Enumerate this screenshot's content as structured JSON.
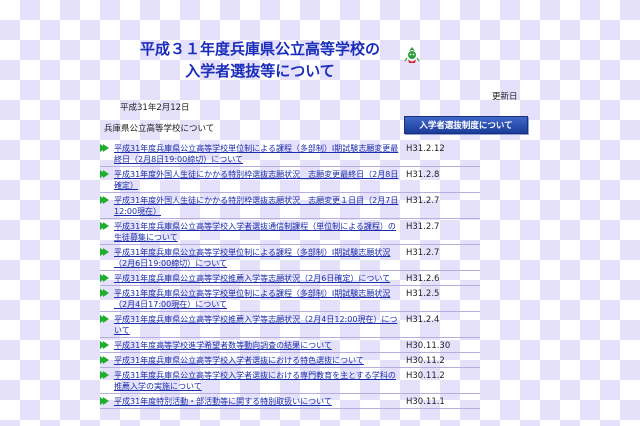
{
  "page": {
    "title_line1": "平成３１年度兵庫県公立高等学校の",
    "title_line2": "入学者選抜等について",
    "date": "平成31年2月12日",
    "update_header": "更新日",
    "section_title": "兵庫県公立高等学校について",
    "banner_label": "入学者選抜制度について"
  },
  "items": [
    {
      "text": "平成31年度兵庫県公立高等学校単位制による課程（多部制）Ⅰ期試験志願変更最終日（2月8日19:00締切）について",
      "date": "H31.2.12"
    },
    {
      "text": "平成31年度外国人生徒にかかる特別枠選抜志願状況　志願変更最終日（2月8日確定）",
      "date": "H31.2.8"
    },
    {
      "text": "平成31年度外国人生徒にかかる特別枠選抜志願状況　志願変更１日目（2月7日12:00現在）",
      "date": "H31.2.7"
    },
    {
      "text": "平成31年度兵庫県公立高等学校入学者選抜通信制課程（単位制による課程）の生徒募集について",
      "date": "H31.2.7"
    },
    {
      "text": "平成31年度兵庫県公立高等学校単位制による課程（多部制）Ⅰ期試験志願状況（2月6日19:00締切）について",
      "date": "H31.2.7"
    },
    {
      "text": "平成31年度兵庫県公立高等学校推薦入学等志願状況（2月6日確定）について",
      "date": "H31.2.6"
    },
    {
      "text": "平成31年度兵庫県公立高等学校単位制による課程（多部制）Ⅰ期試験志願状況（2月4日17:00現在）について",
      "date": "H31.2.5"
    },
    {
      "text": "平成31年度兵庫県公立高等学校推薦入学等志願状況（2月4日12:00現在）について",
      "date": "H31.2.4"
    },
    {
      "text": "平成31年度高等学校進学希望者数等動向調査の結果について",
      "date": "H30.11.30"
    },
    {
      "text": "平成31年度兵庫県公立高等学校入学者選抜における特色選抜について",
      "date": "H30.11.2"
    },
    {
      "text": "平成31年度兵庫県公立高等学校入学者選抜における専門教育を主とする学科の推薦入学の実施について",
      "date": "H30.11.2"
    },
    {
      "text": "平成31年度特別活動・部活動等に関する特別取扱いについて",
      "date": "H30.11.1"
    }
  ],
  "icons": {
    "logo": "hyogo-mascot-icon",
    "bullet": "double-arrow-icon",
    "accent_color": "#1a2dbb",
    "arrow_color": "#1fae2e"
  }
}
